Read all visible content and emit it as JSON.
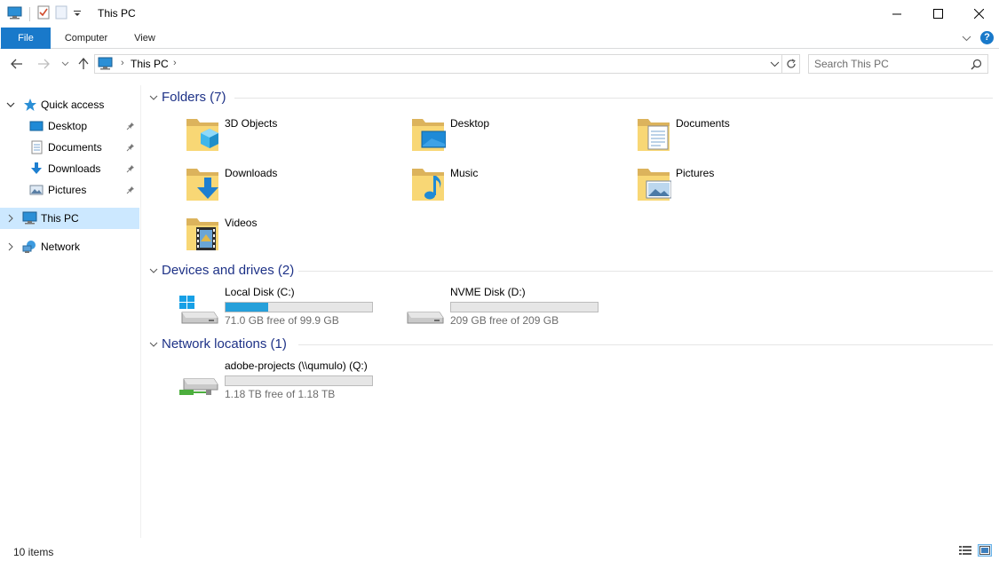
{
  "window": {
    "title": "This PC"
  },
  "ribbon": {
    "tabs": [
      "File",
      "Computer",
      "View"
    ]
  },
  "address": {
    "crumb": "This PC",
    "search_placeholder": "Search This PC"
  },
  "sidebar": {
    "quick_access": "Quick access",
    "quick_items": [
      "Desktop",
      "Documents",
      "Downloads",
      "Pictures"
    ],
    "this_pc": "This PC",
    "network": "Network"
  },
  "groups": {
    "folders": {
      "title": "Folders (7)",
      "items": [
        "3D Objects",
        "Desktop",
        "Documents",
        "Downloads",
        "Music",
        "Pictures",
        "Videos"
      ]
    },
    "drives": {
      "title": "Devices and drives (2)",
      "items": [
        {
          "name": "Local Disk (C:)",
          "free": "71.0 GB free of 99.9 GB",
          "used_fraction": 0.289
        },
        {
          "name": "NVME Disk (D:)",
          "free": "209 GB free of 209 GB",
          "used_fraction": 0.0
        }
      ]
    },
    "network": {
      "title": "Network locations (1)",
      "items": [
        {
          "name": "adobe-projects (\\\\qumulo) (Q:)",
          "free": "1.18 TB free of 1.18 TB",
          "used_fraction": 0.0
        }
      ]
    }
  },
  "status": {
    "count": "10 items"
  },
  "colors": {
    "accent": "#1979ca",
    "selection": "#cce8ff",
    "group_title": "#1e3287",
    "drive_bar": "#26a0da"
  }
}
